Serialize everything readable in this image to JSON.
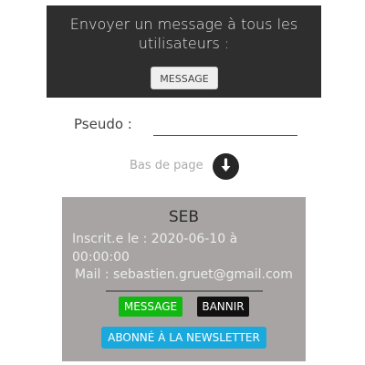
{
  "broadcast": {
    "title": "Envoyer un message à tous les utilisateurs :",
    "message_button": "MESSAGE"
  },
  "form": {
    "pseudo_label": "Pseudo :",
    "pseudo_value": ""
  },
  "scroll": {
    "label": "Bas de page",
    "icon": "arrow-down-circle-icon"
  },
  "user_card": {
    "name": "SEB",
    "registered": "Inscrit.e le : 2020-06-10 à 00:00:00",
    "email": "Mail : sebastien.gruet@gmail.com",
    "message_button": "MESSAGE",
    "ban_button": "BANNIR",
    "newsletter_button": "ABONNÉ À LA NEWSLETTER"
  },
  "colors": {
    "panel_dark": "#2e2e2e",
    "card_bg": "#a8a4a4",
    "message_green": "#12b812",
    "ban_black": "#111111",
    "newsletter_blue": "#1aa9dd"
  }
}
